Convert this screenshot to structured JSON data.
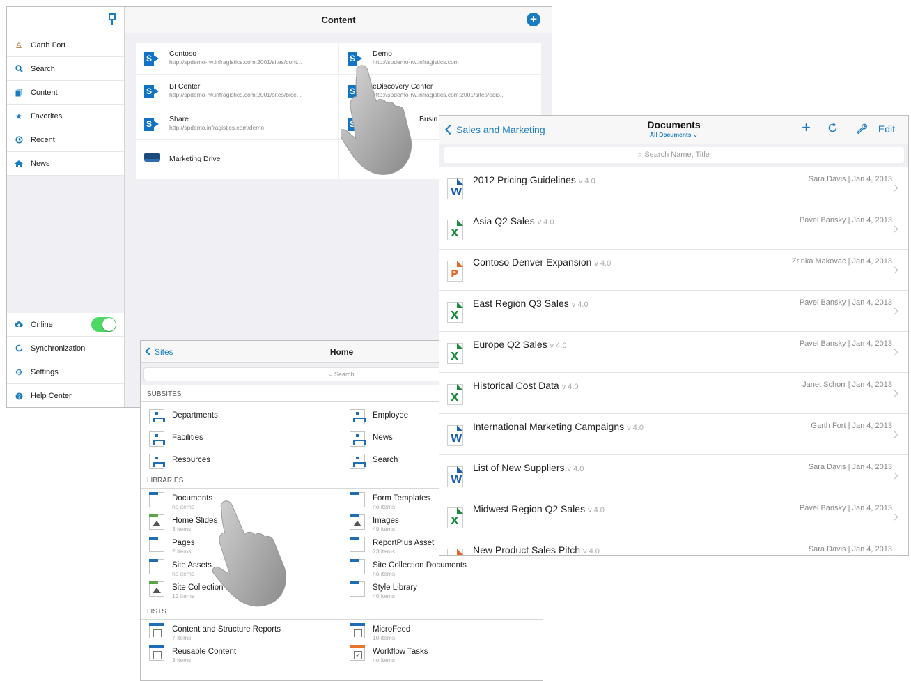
{
  "content_window": {
    "title": "Content",
    "sidebar": {
      "items": [
        {
          "label": "Garth Fort",
          "icon": "user-icon"
        },
        {
          "label": "Search",
          "icon": "search-icon"
        },
        {
          "label": "Content",
          "icon": "content-icon"
        },
        {
          "label": "Favorites",
          "icon": "star-icon"
        },
        {
          "label": "Recent",
          "icon": "clock-icon"
        },
        {
          "label": "News",
          "icon": "home-icon"
        }
      ],
      "bottom": [
        {
          "label": "Online",
          "icon": "cloud-icon",
          "toggle_on": true
        },
        {
          "label": "Synchronization",
          "icon": "sync-icon"
        },
        {
          "label": "Settings",
          "icon": "gear-icon"
        },
        {
          "label": "Help Center",
          "icon": "help-icon"
        }
      ]
    },
    "sites": [
      {
        "title": "Contoso",
        "url": "http://spdemo-rw.infragistics.com:2001/sites/cont..."
      },
      {
        "title": "Demo",
        "url": "http://spdemo-rw.infragistics.com"
      },
      {
        "title": "BI Center",
        "url": "http://spdemo-rw.infragistics.com:2001/sites/bice..."
      },
      {
        "title": "eDiscovery Center",
        "url": "http://spdemo-rw.infragistics.com:2001/sites/edis..."
      },
      {
        "title": "Share",
        "url": "http://spdemo.infragistics.com/demo"
      },
      {
        "title": "Busin",
        "url": ""
      },
      {
        "title": "Marketing Drive",
        "url": ""
      }
    ]
  },
  "home_window": {
    "back_label": "Sites",
    "title": "Home",
    "search_placeholder": "Search",
    "subsites_header": "SUBSITES",
    "subsites": [
      "Departments",
      "Employee",
      "Facilities",
      "News",
      "Resources",
      "Search"
    ],
    "libraries_header": "LIBRARIES",
    "libraries": [
      {
        "label": "Documents",
        "count": "no items"
      },
      {
        "label": "Form Templates",
        "count": "no items"
      },
      {
        "label": "Home Slides",
        "count": "3 items"
      },
      {
        "label": "Images",
        "count": "49 items"
      },
      {
        "label": "Pages",
        "count": "2 items"
      },
      {
        "label": "ReportPlus Asset",
        "count": "23 items"
      },
      {
        "label": "Site Assets",
        "count": "no items"
      },
      {
        "label": "Site Collection Documents",
        "count": "no items"
      },
      {
        "label": "Site Collection I",
        "count": "12 items"
      },
      {
        "label": "Style Library",
        "count": "40 items"
      }
    ],
    "lists_header": "LISTS",
    "lists": [
      {
        "label": "Content and Structure Reports",
        "count": "7 items"
      },
      {
        "label": "MicroFeed",
        "count": "10 items"
      },
      {
        "label": "Reusable Content",
        "count": "3 items"
      },
      {
        "label": "Workflow Tasks",
        "count": "no items"
      }
    ]
  },
  "documents_window": {
    "back_label": "Sales and Marketing",
    "title": "Documents",
    "subtitle": "All Documents",
    "edit_label": "Edit",
    "search_placeholder": "Search Name, Title",
    "docs": [
      {
        "name": "2012 Pricing Guidelines",
        "version": "v 4.0",
        "meta": "Sara Davis | Jan 4, 2013",
        "type": "W"
      },
      {
        "name": "Asia Q2 Sales",
        "version": "v 4.0",
        "meta": "Pavel Bansky | Jan 4, 2013",
        "type": "X"
      },
      {
        "name": "Contoso Denver Expansion",
        "version": "v 4.0",
        "meta": "Zrinka Makovac | Jan 4, 2013",
        "type": "P"
      },
      {
        "name": "East Region Q3 Sales",
        "version": "v 4.0",
        "meta": "Pavel Bansky | Jan 4, 2013",
        "type": "X"
      },
      {
        "name": "Europe Q2 Sales",
        "version": "v 4.0",
        "meta": "Pavel Bansky | Jan 4, 2013",
        "type": "X"
      },
      {
        "name": "Historical Cost Data",
        "version": "v 4.0",
        "meta": "Janet Schorr | Jan 4, 2013",
        "type": "X"
      },
      {
        "name": "International Marketing Campaigns",
        "version": "v 4.0",
        "meta": "Garth Fort | Jan 4, 2013",
        "type": "W"
      },
      {
        "name": "List of New Suppliers",
        "version": "v 4.0",
        "meta": "Sara Davis | Jan 4, 2013",
        "type": "W"
      },
      {
        "name": "Midwest Region Q2 Sales",
        "version": "v 4.0",
        "meta": "Pavel Bansky | Jan 4, 2013",
        "type": "X"
      },
      {
        "name": "New Product Sales Pitch",
        "version": "v 4.0",
        "meta": "Sara Davis | Jan 4, 2013",
        "type": "P"
      }
    ]
  },
  "colors": {
    "accent": "#1a7dc1",
    "toggle_on": "#4cd964",
    "word": "#1a5fb4",
    "excel": "#1a8a3c",
    "powerpoint": "#e8652a"
  }
}
